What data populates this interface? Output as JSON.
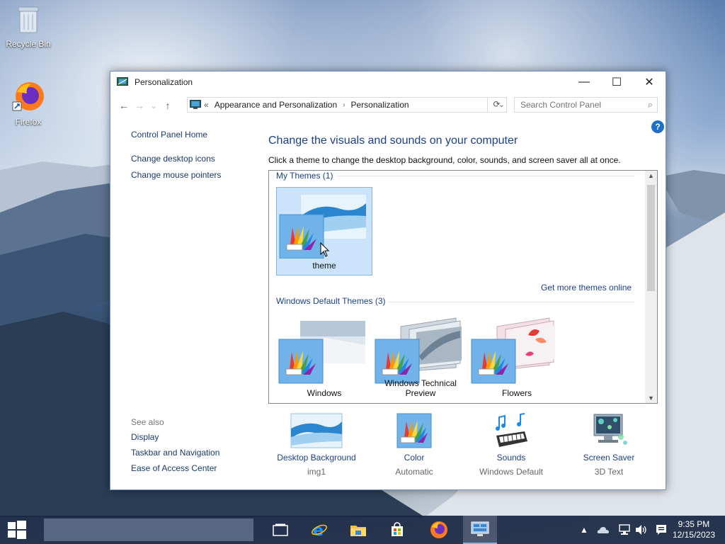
{
  "desktop": {
    "icons": [
      {
        "label": "Recycle Bin",
        "icon": "recycle-bin-icon"
      },
      {
        "label": "Firefox",
        "icon": "firefox-icon"
      }
    ]
  },
  "window": {
    "title": "Personalization",
    "controls": {
      "minimize": "—",
      "maximize": "☐",
      "close": "✕"
    },
    "nav": {
      "back": "←",
      "forward": "→",
      "recent": "⌄",
      "up": "↑"
    },
    "address": {
      "prefix": "«",
      "crumbs": [
        "Appearance and Personalization",
        "Personalization"
      ],
      "separator": "›"
    },
    "search": {
      "placeholder": "Search Control Panel"
    },
    "help": "?"
  },
  "leftnav": {
    "home": "Control Panel Home",
    "links": [
      "Change desktop icons",
      "Change mouse pointers"
    ]
  },
  "see_also": {
    "header": "See also",
    "links": [
      "Display",
      "Taskbar and Navigation",
      "Ease of Access Center"
    ]
  },
  "main": {
    "heading": "Change the visuals and sounds on your computer",
    "subtext": "Click a theme to change the desktop background, color, sounds, and screen saver all at once."
  },
  "themes": {
    "my_themes_header": "My Themes (1)",
    "my_themes": [
      {
        "name": "theme",
        "selected": true
      }
    ],
    "get_more": "Get more themes online",
    "default_header": "Windows Default Themes (3)",
    "default_themes": [
      {
        "name": "Windows"
      },
      {
        "name": "Windows Technical Preview"
      },
      {
        "name": "Flowers"
      }
    ]
  },
  "bottom": [
    {
      "name": "Desktop Background",
      "value": "img1",
      "icon": "desktop-background-icon"
    },
    {
      "name": "Color",
      "value": "Automatic",
      "icon": "color-icon"
    },
    {
      "name": "Sounds",
      "value": "Windows Default",
      "icon": "sounds-icon"
    },
    {
      "name": "Screen Saver",
      "value": "3D Text",
      "icon": "screen-saver-icon"
    }
  ],
  "taskbar": {
    "apps": [
      "task-view-icon",
      "internet-explorer-icon",
      "file-explorer-icon",
      "store-icon",
      "firefox-icon",
      "control-panel-icon"
    ],
    "tray": [
      "show-hidden-icon",
      "onedrive-icon",
      "network-icon",
      "volume-icon",
      "action-center-icon"
    ],
    "time": "9:35 PM",
    "date": "12/15/2023"
  },
  "colors": {
    "accent_link": "#1c3f8c",
    "selection": "#cce4fb",
    "taskbar": "#182642"
  }
}
